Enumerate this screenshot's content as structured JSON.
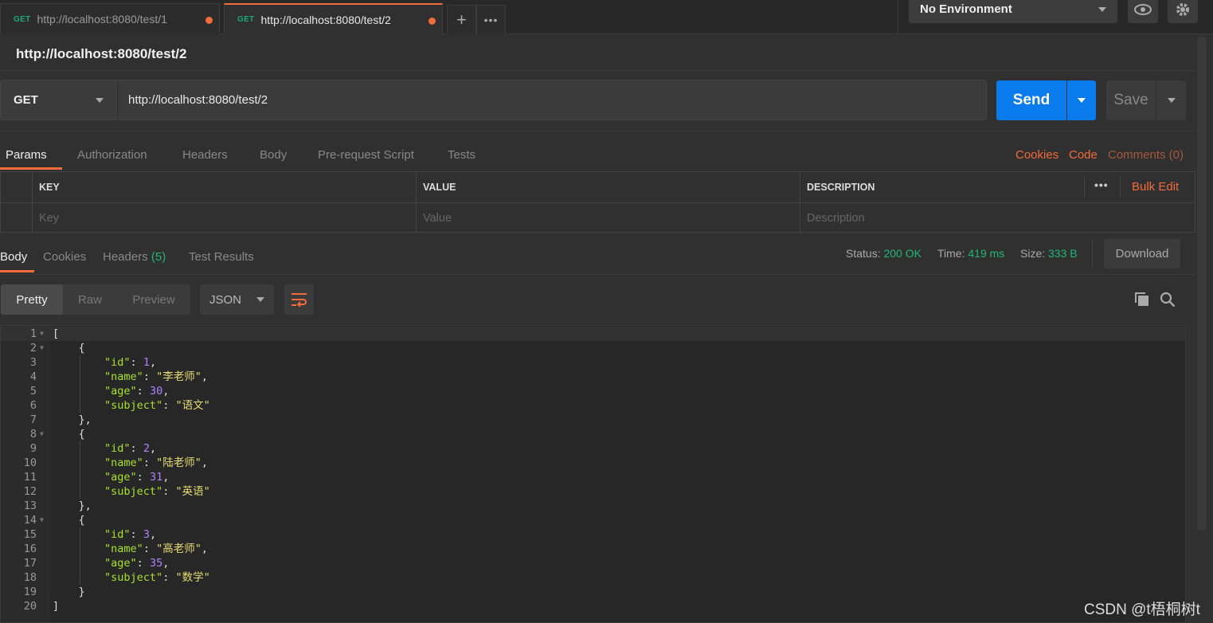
{
  "tabs": [
    {
      "method": "GET",
      "label": "http://localhost:8080/test/1",
      "active": false
    },
    {
      "method": "GET",
      "label": "http://localhost:8080/test/2",
      "active": true
    }
  ],
  "tab_actions": {
    "add": "+",
    "more": "•••"
  },
  "environment": {
    "selected": "No Environment"
  },
  "request": {
    "title": "http://localhost:8080/test/2",
    "method": "GET",
    "url": "http://localhost:8080/test/2",
    "send_label": "Send",
    "save_label": "Save"
  },
  "request_tabs": [
    "Params",
    "Authorization",
    "Headers",
    "Body",
    "Pre-request Script",
    "Tests"
  ],
  "request_links": {
    "cookies": "Cookies",
    "code": "Code",
    "comments": "Comments (0)"
  },
  "params_table": {
    "headers": {
      "key": "KEY",
      "value": "VALUE",
      "description": "DESCRIPTION"
    },
    "more": "•••",
    "bulk_edit": "Bulk Edit",
    "placeholders": {
      "key": "Key",
      "value": "Value",
      "description": "Description"
    }
  },
  "response_tabs": {
    "body": "Body",
    "cookies": "Cookies",
    "headers": "Headers",
    "headers_count": "(5)",
    "test_results": "Test Results"
  },
  "status": {
    "status_label": "Status:",
    "status_value": "200 OK",
    "time_label": "Time:",
    "time_value": "419 ms",
    "size_label": "Size:",
    "size_value": "333 B",
    "download": "Download"
  },
  "view_modes": {
    "pretty": "Pretty",
    "raw": "Raw",
    "preview": "Preview",
    "format": "JSON"
  },
  "code_lines": [
    "[",
    "    {",
    "        \"id\": 1,",
    "        \"name\": \"李老师\",",
    "        \"age\": 30,",
    "        \"subject\": \"语文\"",
    "    },",
    "    {",
    "        \"id\": 2,",
    "        \"name\": \"陆老师\",",
    "        \"age\": 31,",
    "        \"subject\": \"英语\"",
    "    },",
    "    {",
    "        \"id\": 3,",
    "        \"name\": \"高老师\",",
    "        \"age\": 35,",
    "        \"subject\": \"数学\"",
    "    }",
    "]"
  ],
  "fold_lines": [
    1,
    2,
    8,
    14
  ],
  "watermark": "CSDN @t梧桐树t",
  "colors": {
    "accent": "#f26b3a",
    "send": "#097bed",
    "ok": "#21b57d"
  }
}
